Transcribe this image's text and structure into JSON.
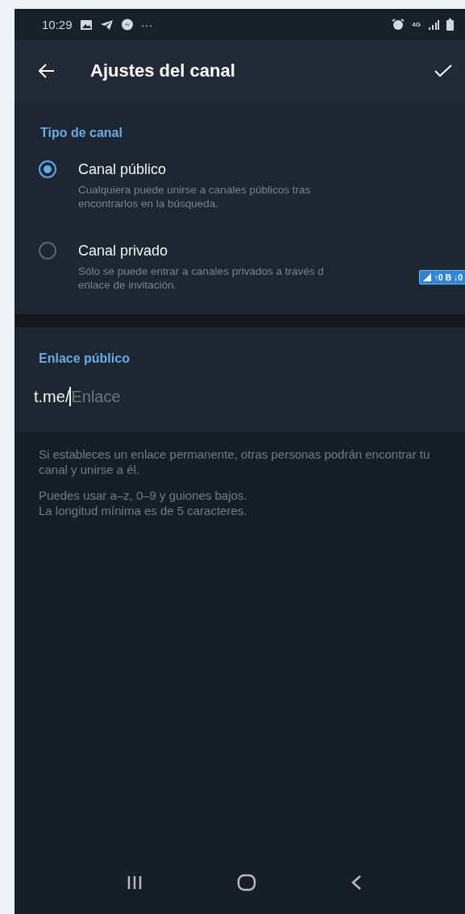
{
  "status_bar": {
    "time": "10:29",
    "more": "···",
    "network": "4G"
  },
  "header": {
    "title": "Ajustes del canal"
  },
  "channel_type": {
    "heading": "Tipo de canal",
    "options": [
      {
        "label": "Canal público",
        "description": [
          "Cualquiera puede unirse a canales públicos tras",
          "encontrarlos en la búsqueda."
        ],
        "selected": true
      },
      {
        "label": "Canal privado",
        "description": [
          "Sólo se puede entrar a canales privados a través d",
          "enlace de invitación."
        ],
        "selected": false
      }
    ]
  },
  "speed_overlay": {
    "text": "↑0 B ↓0"
  },
  "public_link": {
    "heading": "Enlace público",
    "prefix": "t.me/",
    "placeholder": "Enlace"
  },
  "help": [
    "Si estableces un enlace permanente, otras personas podrán encontrar tu canal y unirse a él.",
    "Puedes usar a–z, 0–9 y guiones bajos.\nLa longitud mínima es de 5 caracteres."
  ]
}
